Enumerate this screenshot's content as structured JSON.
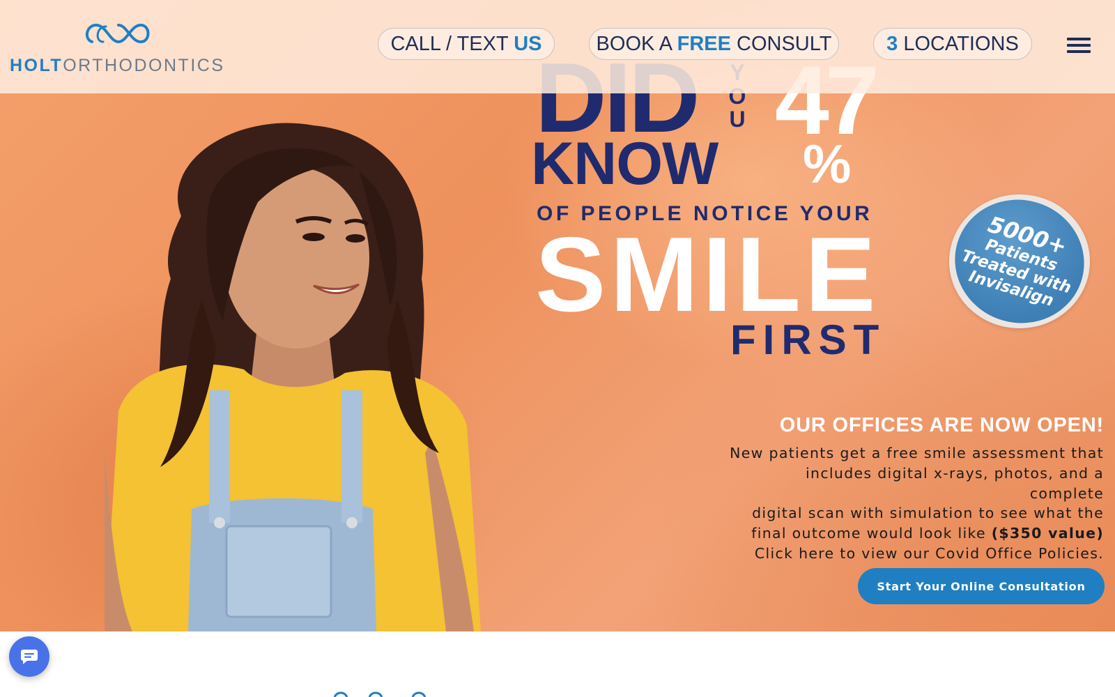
{
  "header": {
    "logo": {
      "bold": "HOLT",
      "light": "ORTHODONTICS",
      "mark_icon": "infinity-logo-icon"
    },
    "nav": {
      "call": {
        "prefix": "CALL / TEXT ",
        "highlight": "US"
      },
      "book": {
        "prefix": "BOOK A ",
        "highlight": "FREE",
        "suffix": " CONSULT"
      },
      "locations": {
        "highlight": "3",
        "suffix": " LOCATIONS"
      }
    },
    "menu_icon": "hamburger-menu-icon"
  },
  "hero": {
    "did": "DID",
    "you": [
      "Y",
      "O",
      "U"
    ],
    "know": "KNOW",
    "number": "47",
    "percent": "%",
    "notice": "OF PEOPLE NOTICE YOUR",
    "smile": "SMILE",
    "first": "FIRST",
    "badge": {
      "line1": "5000+",
      "line2": "Patients",
      "line3": "Treated with",
      "line4": "Invisalign"
    }
  },
  "info": {
    "title": "OUR OFFICES ARE NOW OPEN!",
    "line1": "New patients get a free smile assessment that",
    "line2": "includes digital x-rays, photos, and a complete",
    "line3": "digital scan with simulation to see what the",
    "line4_prefix": "final outcome would look like ",
    "line4_strong": "($350 value)",
    "covid_link": "Click here to view our Covid Office Policies.",
    "cta": "Start Your Online Consultation"
  },
  "chat": {
    "icon": "chat-bubble-icon"
  },
  "colors": {
    "navy": "#1f2b6e",
    "brand_blue": "#1f7fc2",
    "hero_orange": "#ee915c",
    "chat_blue": "#4a72e8"
  }
}
